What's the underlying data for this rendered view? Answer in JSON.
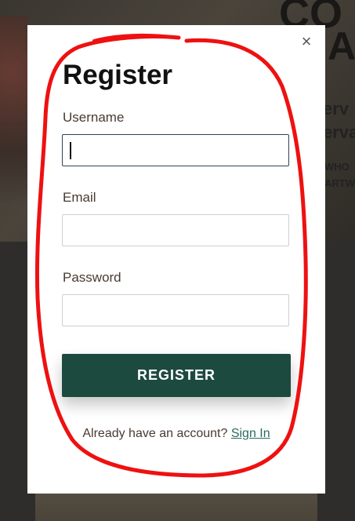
{
  "background": {
    "heading_line1": "CO",
    "heading_line2": "A",
    "sub_line1": "erv",
    "sub_line2": "erva",
    "small_line1": "WHO",
    "small_line2": "ARTW"
  },
  "modal": {
    "title": "Register",
    "close_icon": "×",
    "fields": {
      "username": {
        "label": "Username",
        "value": ""
      },
      "email": {
        "label": "Email",
        "value": ""
      },
      "password": {
        "label": "Password",
        "value": ""
      }
    },
    "submit_label": "REGISTER",
    "footer_text": "Already have an account?",
    "signin_label": "Sign In"
  },
  "colors": {
    "button": "#1d4a3e",
    "link": "#2a6a5e",
    "annotation": "#ee1111"
  }
}
